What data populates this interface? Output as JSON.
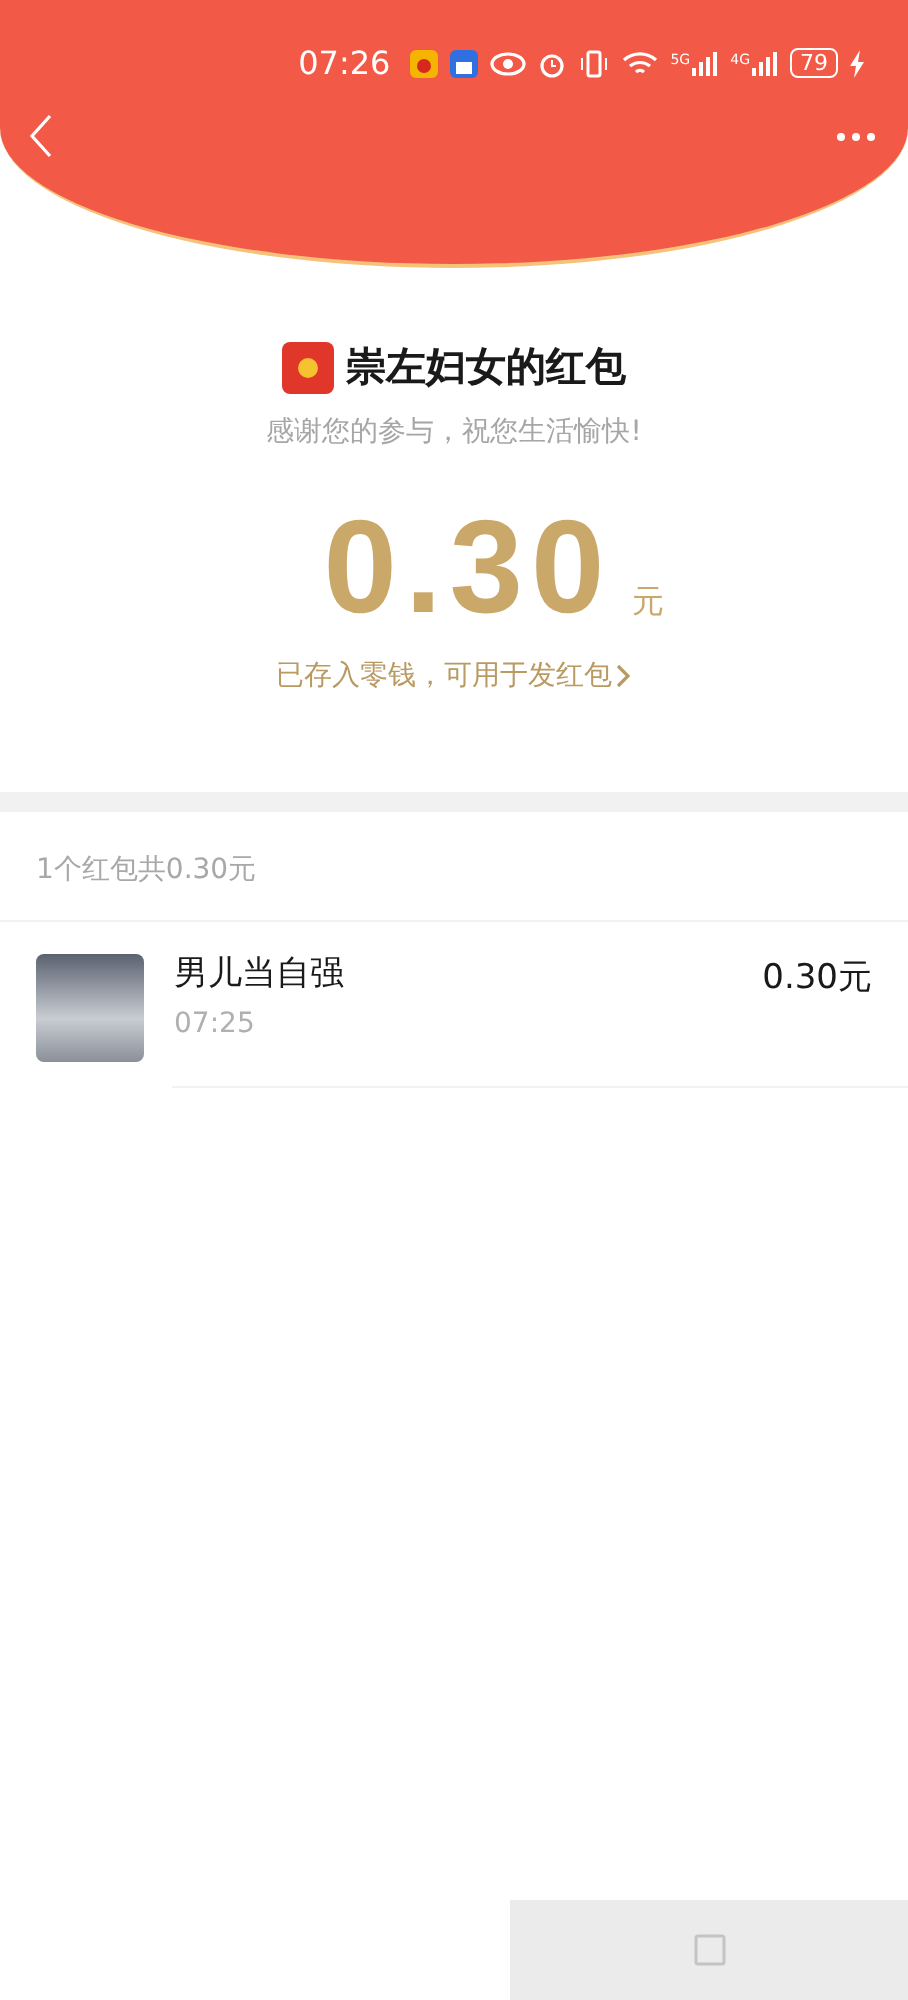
{
  "status_bar": {
    "time": "07:26",
    "network_1": "5G",
    "network_2": "4G",
    "battery": "79"
  },
  "header": {
    "title": "崇左妇女的红包",
    "greeting": "感谢您的参与，祝您生活愉快!",
    "amount": "0.30",
    "currency": "元",
    "wallet_link": "已存入零钱，可用于发红包"
  },
  "summary": "1个红包共0.30元",
  "records": [
    {
      "name": "男儿当自强",
      "time": "07:25",
      "amount": "0.30元"
    }
  ]
}
